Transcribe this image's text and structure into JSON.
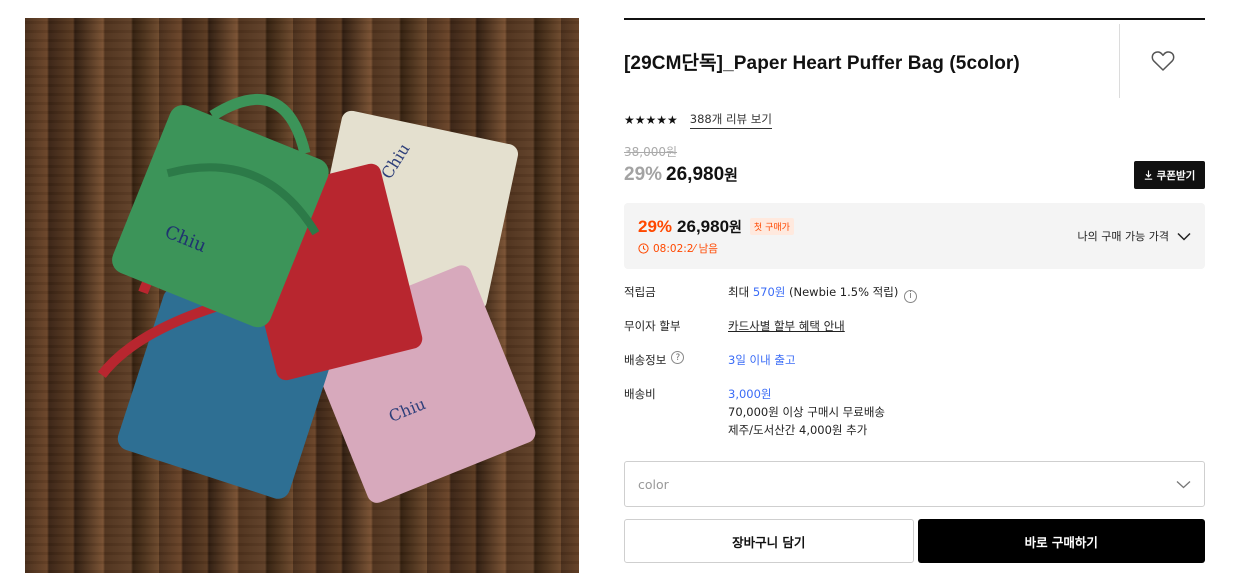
{
  "product": {
    "title": "[29CM단독]_Paper Heart Puffer Bag (5color)",
    "image_alt": "Five colored puffer bags on wooden floor",
    "stars": "★★★★★",
    "review_link": "388개 리뷰 보기",
    "original_price": "38,000원",
    "discount_pct": "29%",
    "sale_amount": "26,980",
    "won": "원",
    "coupon_button": "쿠폰받기"
  },
  "my_price": {
    "discount_pct": "29%",
    "amount": "26,980",
    "won": "원",
    "badge": "첫 구매가",
    "timer": "08:02:2⁄ 남음",
    "toggle_label": "나의 구매 가능 가격"
  },
  "details": {
    "points_label": "적립금",
    "points_prefix": "최대",
    "points_amount": "570원",
    "points_suffix": "(Newbie 1.5% 적립)",
    "installment_label": "무이자 할부",
    "installment_value": "카드사별 할부 혜택 안내",
    "shipping_info_label": "배송정보",
    "shipping_info_value": "3일 이내 출고",
    "shipping_fee_label": "배송비",
    "shipping_fee_value": "3,000원",
    "shipping_fee_note1": "70,000원 이상 구매시 무료배송",
    "shipping_fee_note2": "제주/도서산간 4,000원 추가"
  },
  "option_select": {
    "placeholder": "color"
  },
  "actions": {
    "cart": "장바구니 담기",
    "buy": "바로 구매하기"
  },
  "colors": {
    "accent_orange": "#ff4800",
    "accent_blue": "#3b6cf6",
    "black": "#000000"
  },
  "icons": [
    "heart-icon",
    "download-icon",
    "clock-icon",
    "chevron-down-icon",
    "help-icon",
    "info-icon"
  ]
}
